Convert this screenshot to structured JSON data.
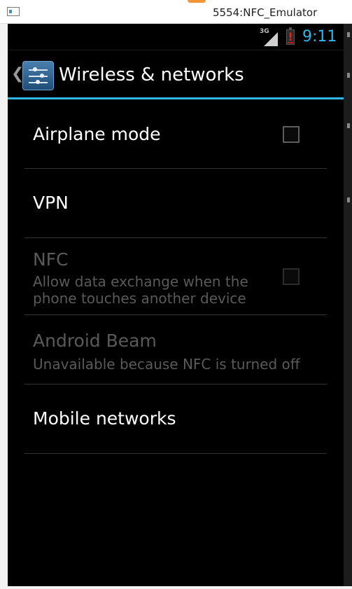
{
  "window": {
    "title": "5554:NFC_Emulator"
  },
  "statusbar": {
    "network_type": "3G",
    "time": "9:11",
    "icons": [
      "signal-icon",
      "battery-alert-icon"
    ]
  },
  "actionbar": {
    "title": "Wireless & networks",
    "icon": "settings-icon"
  },
  "settings": {
    "airplane_mode": {
      "label": "Airplane mode",
      "checked": false
    },
    "vpn": {
      "label": "VPN"
    },
    "nfc": {
      "label": "NFC",
      "summary": "Allow data exchange when the phone touches another device",
      "checked": false,
      "enabled": false
    },
    "android_beam": {
      "label": "Android Beam",
      "summary": "Unavailable because NFC is turned off",
      "enabled": false
    },
    "mobile_networks": {
      "label": "Mobile networks"
    }
  },
  "colors": {
    "accent": "#33b5e5",
    "background": "#000000",
    "disabled_text": "#5a5a5a",
    "battery_alert": "#e42323"
  }
}
